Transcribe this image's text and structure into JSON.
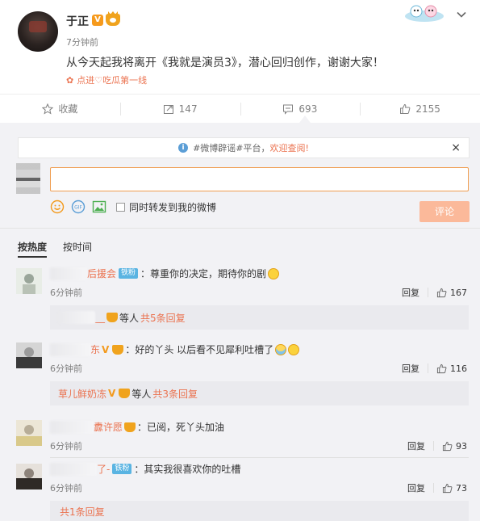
{
  "post": {
    "author": "于正",
    "verified": "V",
    "time": "7分钟前",
    "text": "从今天起我将离开《我就是演员3》，潜心回归创作，谢谢大家！",
    "source": "点进♡吃瓜第一线"
  },
  "actions": {
    "favorite": "收藏",
    "repost": "147",
    "comment": "693",
    "like": "2155"
  },
  "compose": {
    "rumor_prefix": "#微博辟谣#平台，",
    "rumor_link": "欢迎查阅!",
    "close": "×",
    "forward_label": "同时转发到我的微博",
    "submit": "评论"
  },
  "sort": {
    "hot": "按热度",
    "time": "按时间"
  },
  "comments": [
    {
      "name_visible": "后援会",
      "badge": "铁粉",
      "text": "：尊重你的决定，期待你的剧",
      "time": "6分钟前",
      "reply": "回复",
      "likes": "167",
      "sub": {
        "name": "__",
        "etc": "等人",
        "count": "共5条回复"
      }
    },
    {
      "name_visible": "东",
      "verified": "V",
      "text": "：好的丫头 以后看不见犀利吐槽了",
      "time": "6分钟前",
      "reply": "回复",
      "likes": "116",
      "sub": {
        "name": "草儿鲜奶冻",
        "verified": "V",
        "etc": "等人",
        "count": "共3条回复"
      }
    },
    {
      "name_visible": "纛许愿",
      "text": "：已阅，死丫头加油",
      "time": "6分钟前",
      "reply": "回复",
      "likes": "93"
    },
    {
      "name_visible": "了-",
      "badge": "铁粉",
      "text": "：其实我很喜欢你的吐槽",
      "time": "6分钟前",
      "reply": "回复",
      "likes": "73",
      "sub_only": "共1条回复"
    }
  ]
}
